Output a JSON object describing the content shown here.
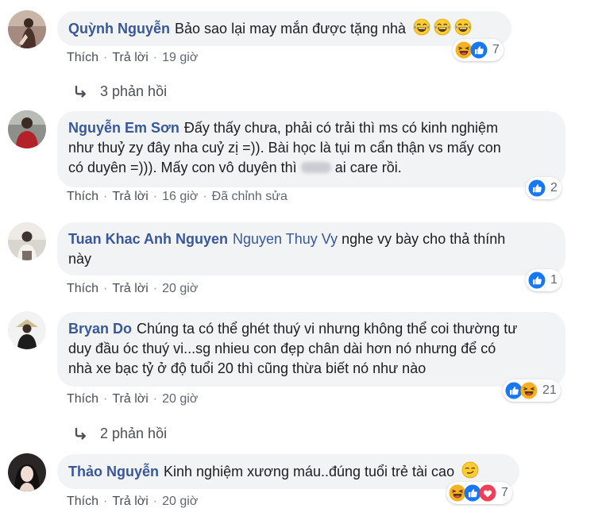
{
  "comments": [
    {
      "author": "Quỳnh Nguyễn",
      "text": "Bảo sao lại may mắn được tặng nhà",
      "actions": {
        "like": "Thích",
        "reply": "Trả lời",
        "time": "19 giờ"
      },
      "reaction_count": "7",
      "reactions": [
        "haha",
        "like"
      ],
      "replies_label": "3 phản hồi"
    },
    {
      "author": "Nguyễn Em Sơn",
      "text_line1": "Đấy thấy chưa, phải có trải thì ms có kinh nghiệm",
      "text_line2": "như thuỷ zy đây nha cuỷ zị =)). Bài học là tụi m cẩn thận vs mấy con",
      "text_line3a": "có duyên =))). Mấy con vô duyên thì",
      "text_line3b": "ai care rồi.",
      "actions": {
        "like": "Thích",
        "reply": "Trả lời",
        "time": "16 giờ",
        "edited": "Đã chỉnh sửa"
      },
      "reaction_count": "2",
      "reactions": [
        "like"
      ]
    },
    {
      "author": "Tuan Khac Anh Nguyen",
      "mention": "Nguyen Thuy Vy",
      "text_line1": "nghe vy bày cho thả thính",
      "text_line2": "này",
      "actions": {
        "like": "Thích",
        "reply": "Trả lời",
        "time": "20 giờ"
      },
      "reaction_count": "1",
      "reactions": [
        "like"
      ]
    },
    {
      "author": "Bryan Do",
      "text_line1": "Chúng ta có thể ghét thuý vi nhưng không thể coi thường tư",
      "text_line2": "duy đầu óc thuý vi...sg nhieu con đẹp chân dài hơn nó nhưng để có",
      "text_line3": "nhà xe bạc tỷ ở độ tuổi 20 thì cũng thừa biết nó như nào",
      "actions": {
        "like": "Thích",
        "reply": "Trả lời",
        "time": "20 giờ"
      },
      "reaction_count": "21",
      "reactions": [
        "like",
        "haha"
      ],
      "replies_label": "2 phản hồi"
    },
    {
      "author": "Thảo Nguyễn",
      "text": "Kinh nghiệm xương máu..đúng tuổi trẻ tài cao",
      "actions": {
        "like": "Thích",
        "reply": "Trả lời",
        "time": "20 giờ"
      },
      "reaction_count": "7",
      "reactions": [
        "haha",
        "like",
        "love"
      ]
    }
  ],
  "colors": {
    "author": "#385898",
    "bubble": "#f2f3f5",
    "meta": "#616770",
    "like": "#1877f2",
    "love": "#f33e58",
    "haha": "#f7b125"
  }
}
